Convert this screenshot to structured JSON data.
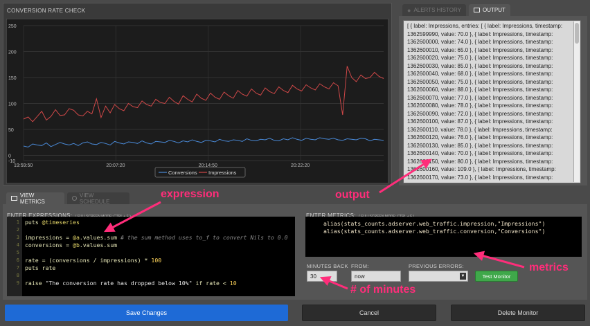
{
  "chart_panel": {
    "title": "CONVERSION RATE CHECK"
  },
  "chart_data": {
    "type": "line",
    "title": "",
    "xlabel": "",
    "ylabel": "",
    "ylim": [
      -10,
      250
    ],
    "yticks": [
      "250",
      "200",
      "150",
      "100",
      "50",
      "0",
      "-10"
    ],
    "xticks": [
      "19:59:50",
      "20:07:20",
      "20:14:50",
      "20:22:20"
    ],
    "legend_position": "bottom-center",
    "series": [
      {
        "name": "Conversions",
        "color": "#4a8ad8",
        "values": [
          18,
          16,
          22,
          20,
          19,
          24,
          17,
          21,
          25,
          22,
          20,
          23,
          19,
          24,
          26,
          22,
          21,
          25,
          23,
          20,
          27,
          24,
          22,
          26,
          25,
          23,
          28,
          24,
          22,
          27,
          26,
          25,
          29,
          27,
          24,
          28,
          26,
          30,
          27,
          25,
          29,
          28,
          26,
          31,
          28,
          27,
          30,
          29,
          27,
          32,
          29,
          28,
          31,
          30,
          33,
          29,
          28,
          32,
          30,
          34,
          31,
          29,
          33,
          31,
          30,
          34,
          32,
          31,
          33,
          30,
          29,
          32,
          31,
          30,
          33,
          32,
          28,
          31,
          30,
          29
        ]
      },
      {
        "name": "Impressions",
        "color": "#d04848",
        "values": [
          70,
          74,
          65,
          75,
          85,
          68,
          75,
          88,
          77,
          78,
          90,
          87,
          78,
          76,
          85,
          80,
          109,
          73,
          95,
          82,
          98,
          90,
          86,
          100,
          94,
          92,
          105,
          98,
          95,
          108,
          102,
          100,
          112,
          104,
          99,
          115,
          108,
          103,
          118,
          110,
          106,
          120,
          112,
          108,
          122,
          115,
          110,
          125,
          118,
          114,
          128,
          120,
          116,
          130,
          123,
          119,
          132,
          125,
          121,
          135,
          128,
          124,
          136,
          130,
          126,
          138,
          132,
          128,
          140,
          134,
          78,
          172,
          150,
          142,
          155,
          148,
          150,
          160,
          152,
          148
        ]
      }
    ]
  },
  "tabs_right": {
    "alerts_history": "ALERTS HISTORY",
    "output": "OUTPUT"
  },
  "output_text": "[ { label: Impressions, entries: [ { label: Impressions, timestamp: 1362599990, value: 70.0 }, { label: Impressions, timestamp: 1362600000, value: 74.0 }, { label: Impressions, timestamp: 1362600010, value: 65.0 }, { label: Impressions, timestamp: 1362600020, value: 75.0 }, { label: Impressions, timestamp: 1362600030, value: 85.0 }, { label: Impressions, timestamp: 1362600040, value: 68.0 }, { label: Impressions, timestamp: 1362600050, value: 75.0 }, { label: Impressions, timestamp: 1362600060, value: 88.0 }, { label: Impressions, timestamp: 1362600070, value: 77.0 }, { label: Impressions, timestamp: 1362600080, value: 78.0 }, { label: Impressions, timestamp: 1362600090, value: 72.0 }, { label: Impressions, timestamp: 1362600100, value: 87.0 }, { label: Impressions, timestamp: 1362600110, value: 78.0 }, { label: Impressions, timestamp: 1362600120, value: 76.0 }, { label: Impressions, timestamp: 1362600130, value: 85.0 }, { label: Impressions, timestamp: 1362600140, value: 70.0 }, { label: Impressions, timestamp: 1362600150, value: 80.0 }, { label: Impressions, timestamp: 1362600160, value: 109.0 }, { label: Impressions, timestamp: 1362600170, value: 73.0 }, { label: Impressions, timestamp:",
  "tabs_left": {
    "view_metrics": "VIEW METRICS",
    "view_schedule": "VIEW SCHEDULE"
  },
  "expressions": {
    "label": "ENTER EXPRESSIONS:",
    "hint": "( FULLSCREEN MODE: CTRL + F )"
  },
  "metrics": {
    "label": "ENTER METRICS:",
    "hint": "( FULLSCREEN MODE: CTRL + F )",
    "line1": "alias(stats_counts.adserver.web_traffic.impression,\"Impressions\")",
    "line2": "alias(stats_counts.adserver.web_traffic.conversion,\"Conversions\")"
  },
  "code_lines": [
    "1",
    "2",
    "3",
    "4",
    "5",
    "6",
    "7",
    "8",
    "9"
  ],
  "controls": {
    "minutes_back_label": "MINUTES BACK",
    "minutes_back_value": "30",
    "from_label": "FROM:",
    "from_value": "now",
    "previous_errors_label": "PREVIOUS ERRORS:",
    "test_monitor": "Test Monitor"
  },
  "footer": {
    "save": "Save Changes",
    "cancel": "Cancel",
    "delete": "Delete Monitor"
  },
  "annotations": {
    "expression": "expression",
    "output": "output",
    "metrics": "metrics",
    "minutes": "# of minutes"
  },
  "colors": {
    "accent_blue": "#1e6ad6",
    "accent_green": "#3fa84a",
    "annotation_pink": "#ff2d7a"
  }
}
